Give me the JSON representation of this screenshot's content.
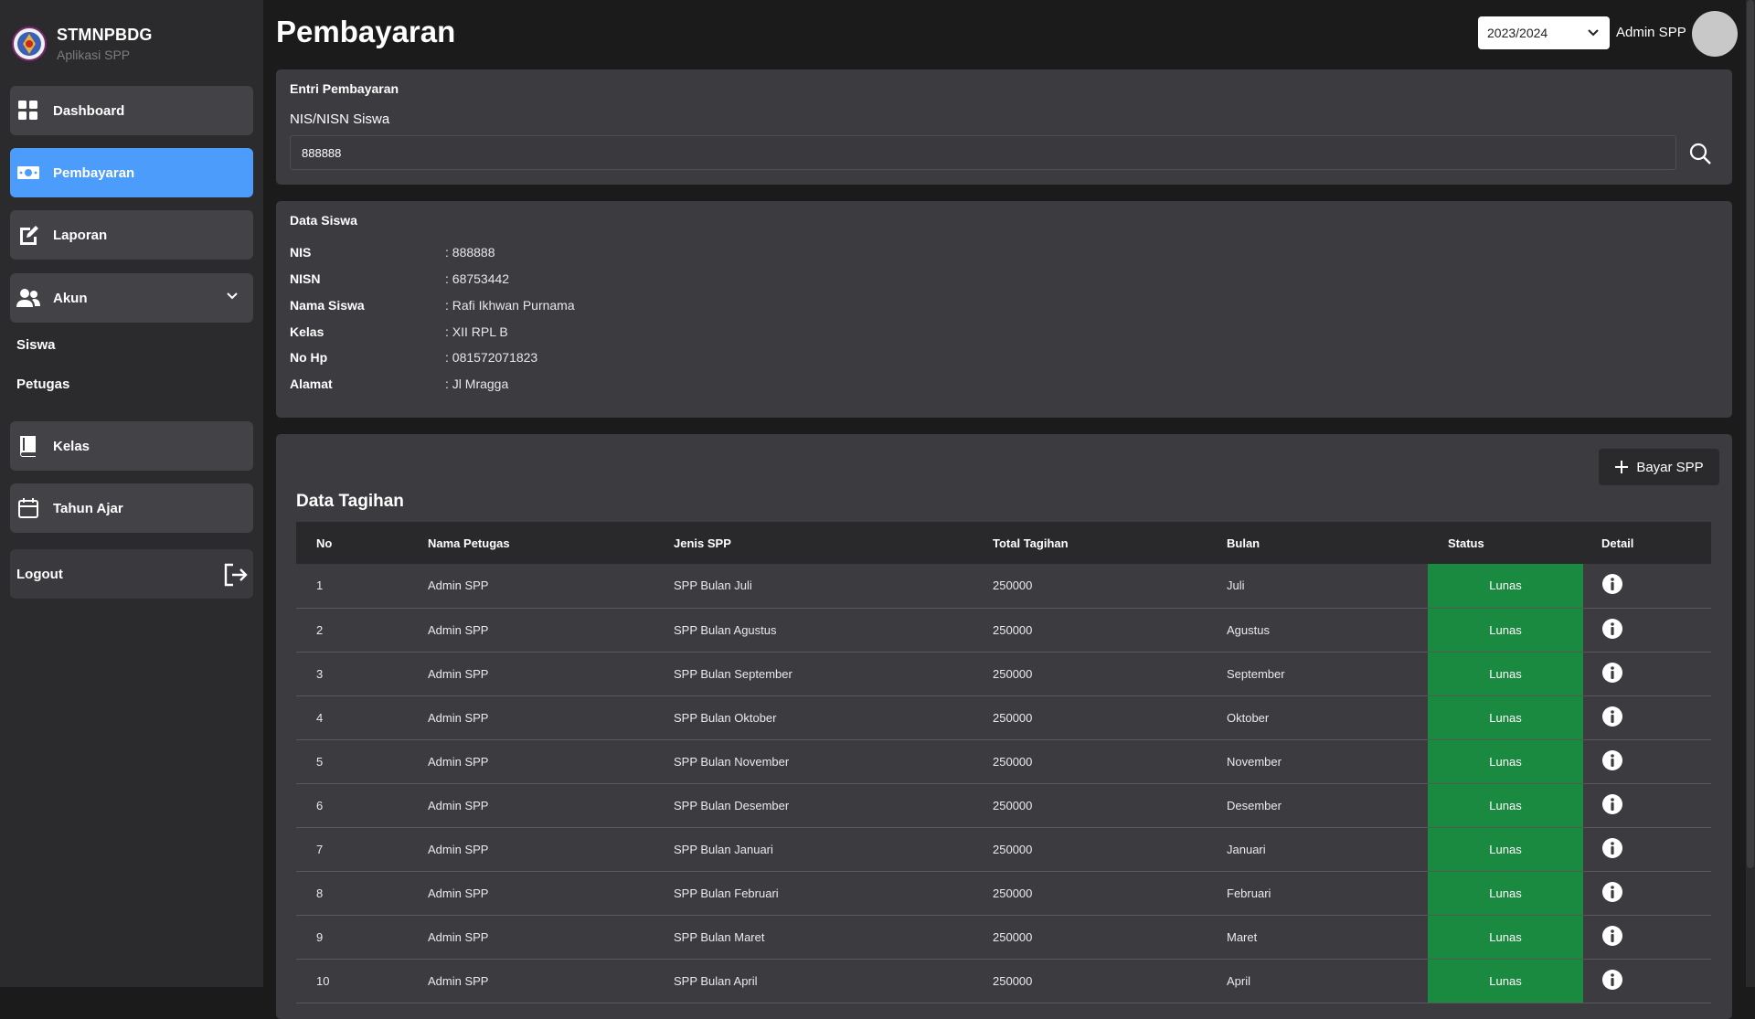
{
  "brand": {
    "name": "STMNPBDG",
    "subtitle": "Aplikasi SPP",
    "logo_icon": "school-emblem-icon"
  },
  "sidebar": {
    "items": [
      {
        "label": "Dashboard",
        "icon": "grid-icon"
      },
      {
        "label": "Pembayaran",
        "icon": "money-icon",
        "active": true
      },
      {
        "label": "Laporan",
        "icon": "edit-document-icon"
      },
      {
        "label": "Akun",
        "icon": "users-icon"
      },
      {
        "label": "Kelas",
        "icon": "book-icon"
      },
      {
        "label": "Tahun Ajar",
        "icon": "calendar-icon"
      }
    ],
    "akun_sub": [
      "Siswa",
      "Petugas"
    ],
    "logout_label": "Logout"
  },
  "header": {
    "title": "Pembayaran",
    "year": "2023/2024",
    "user": "Admin SPP"
  },
  "entry": {
    "title": "Entri Pembayaran",
    "field_label": "NIS/NISN Siswa",
    "nis_value": "888888"
  },
  "siswa": {
    "title": "Data Siswa",
    "rows": [
      {
        "key": "NIS",
        "value": ": 888888"
      },
      {
        "key": "NISN",
        "value": ": 68753442"
      },
      {
        "key": "Nama Siswa",
        "value": ": Rafi Ikhwan Purnama"
      },
      {
        "key": "Kelas",
        "value": ": XII RPL B"
      },
      {
        "key": "No Hp",
        "value": ": 081572071823"
      },
      {
        "key": "Alamat",
        "value": ": Jl Mragga"
      }
    ]
  },
  "tagihan": {
    "title": "Data Tagihan",
    "bayar_label": "Bayar SPP",
    "columns": [
      "No",
      "Nama Petugas",
      "Jenis SPP",
      "Total Tagihan",
      "Bulan",
      "Status",
      "Detail"
    ],
    "rows": [
      {
        "no": "1",
        "petugas": "Admin SPP",
        "jenis": "SPP Bulan Juli",
        "total": "250000",
        "bulan": "Juli",
        "status": "Lunas"
      },
      {
        "no": "2",
        "petugas": "Admin SPP",
        "jenis": "SPP Bulan Agustus",
        "total": "250000",
        "bulan": "Agustus",
        "status": "Lunas"
      },
      {
        "no": "3",
        "petugas": "Admin SPP",
        "jenis": "SPP Bulan September",
        "total": "250000",
        "bulan": "September",
        "status": "Lunas"
      },
      {
        "no": "4",
        "petugas": "Admin SPP",
        "jenis": "SPP Bulan Oktober",
        "total": "250000",
        "bulan": "Oktober",
        "status": "Lunas"
      },
      {
        "no": "5",
        "petugas": "Admin SPP",
        "jenis": "SPP Bulan November",
        "total": "250000",
        "bulan": "November",
        "status": "Lunas"
      },
      {
        "no": "6",
        "petugas": "Admin SPP",
        "jenis": "SPP Bulan Desember",
        "total": "250000",
        "bulan": "Desember",
        "status": "Lunas"
      },
      {
        "no": "7",
        "petugas": "Admin SPP",
        "jenis": "SPP Bulan Januari",
        "total": "250000",
        "bulan": "Januari",
        "status": "Lunas"
      },
      {
        "no": "8",
        "petugas": "Admin SPP",
        "jenis": "SPP Bulan Februari",
        "total": "250000",
        "bulan": "Februari",
        "status": "Lunas"
      },
      {
        "no": "9",
        "petugas": "Admin SPP",
        "jenis": "SPP Bulan Maret",
        "total": "250000",
        "bulan": "Maret",
        "status": "Lunas"
      },
      {
        "no": "10",
        "petugas": "Admin SPP",
        "jenis": "SPP Bulan April",
        "total": "250000",
        "bulan": "April",
        "status": "Lunas"
      }
    ]
  },
  "colors": {
    "accent": "#4c9dfb",
    "lunas": "#198a3f",
    "sidebar": "#2b2b2d",
    "card": "#3c3c40"
  }
}
